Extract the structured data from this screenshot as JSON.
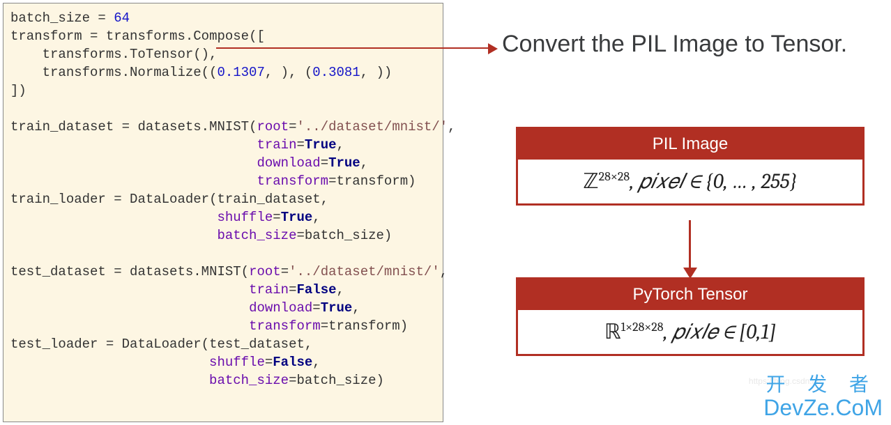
{
  "code": {
    "batch_size_var": "batch_size",
    "batch_size_val": "64",
    "transform_var": "transform",
    "compose_call": "transforms.Compose([",
    "to_tensor": "transforms.ToTensor(),",
    "normalize_pre": "transforms.Normalize((",
    "norm_v1": "0.1307",
    "norm_mid": ", ), (",
    "norm_v2": "0.3081",
    "norm_end": ", ))",
    "close_bracket": "])",
    "train_ds": "train_dataset",
    "mnist_call": "datasets.MNIST(",
    "root_kw": "root",
    "root_val": "'../dataset/mnist/'",
    "train_kw": "train",
    "true_val": "True",
    "false_val": "False",
    "download_kw": "download",
    "transform_kw": "transform",
    "train_loader": "train_loader",
    "dataloader": "DataLoader(",
    "shuffle_kw": "shuffle",
    "batch_kw": "batch_size",
    "test_ds": "test_dataset",
    "test_loader": "test_loader"
  },
  "annotation": "Convert the PIL Image to Tensor.",
  "diagram": {
    "box1_title": "PIL Image",
    "box1_math_z": "ℤ",
    "box1_sup": "28×28",
    "box1_rest": ", 𝑝𝑖𝑥𝑒𝑙 ∈ {0, … , 255}",
    "box2_title": "PyTorch Tensor",
    "box2_math_r": "ℝ",
    "box2_sup": "1×28×28",
    "box2_rest": ", 𝑝𝑖𝑥𝑙𝑒 ∈ [0,1]"
  },
  "watermark": {
    "cn": "开 发 者",
    "en": "DevZe.CoM",
    "faint": "https://blog.csdn.ne"
  }
}
